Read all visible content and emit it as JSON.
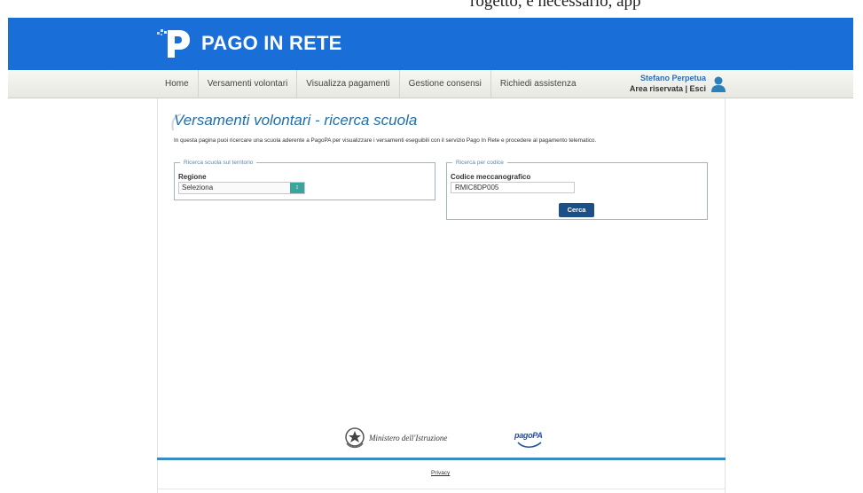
{
  "top_crop": {
    "text": "rogetto, è necessario, app"
  },
  "header": {
    "logo_text": "PAGO IN RETE"
  },
  "nav": {
    "items": [
      "Home",
      "Versamenti volontari",
      "Visualizza pagamenti",
      "Gestione consensi",
      "Richiedi assistenza"
    ]
  },
  "user": {
    "name": "Stefano Perpetua",
    "area": "Area riservata | Esci"
  },
  "page": {
    "title": "Versamenti volontari - ricerca scuola",
    "intro": "In questa pagina puoi ricercare una scuola aderente a PagoPA per visualizzare i versamenti eseguibili con il servizio Pago In Rete e procedere al pagamento telematico."
  },
  "search_territory": {
    "legend": "Ricerca scuola sul territorio",
    "region_label": "Regione",
    "region_value": "Seleziona"
  },
  "search_code": {
    "legend": "Ricerca per codice",
    "code_label": "Codice meccanografico",
    "code_value": "RMIC8DP005",
    "button_label": "Cerca"
  },
  "footer": {
    "ministry": "Ministero dell'Istruzione",
    "pagopa": "pagoPA",
    "privacy": "Privacy"
  },
  "colors": {
    "header_blue": "#1a6ed8",
    "title_blue": "#1f6fa8",
    "button_navy": "#1c4f86",
    "select_teal": "#3aa59b"
  }
}
